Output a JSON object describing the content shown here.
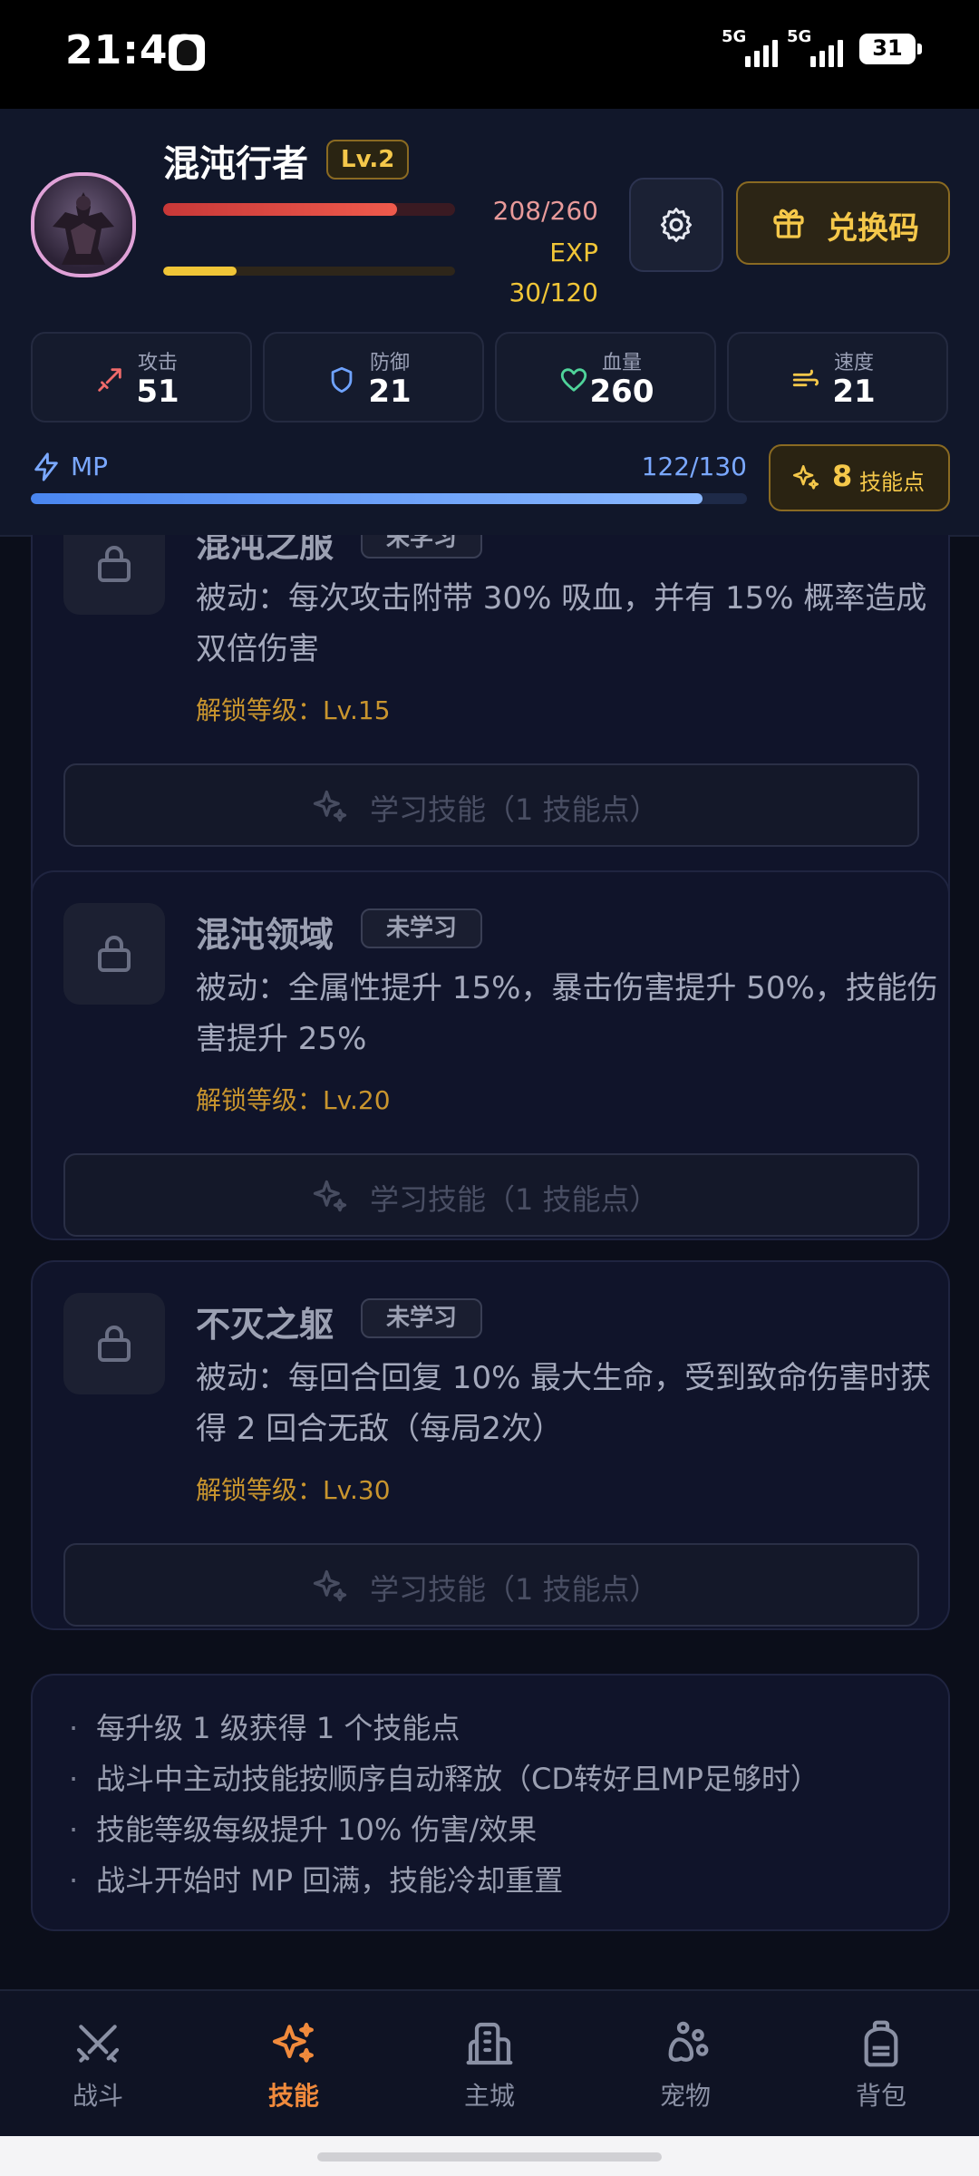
{
  "status_bar": {
    "time": "21:46",
    "net1": "5G",
    "net2": "5G",
    "battery": "31"
  },
  "player": {
    "name": "混沌行者",
    "level": "Lv.2",
    "hp_text": "208/260",
    "hp_fraction": 0.8,
    "exp_label": "EXP",
    "exp_text": "30/120",
    "exp_fraction": 0.25
  },
  "header": {
    "redeem_label": "兑换码"
  },
  "stats": [
    {
      "label": "攻击",
      "value": "51",
      "icon": "sword-icon"
    },
    {
      "label": "防御",
      "value": "21",
      "icon": "shield-icon"
    },
    {
      "label": "血量",
      "value": "260",
      "icon": "heart-icon"
    },
    {
      "label": "速度",
      "value": "21",
      "icon": "wind-icon"
    }
  ],
  "mp": {
    "label": "MP",
    "text": "122/130",
    "fraction": 0.938
  },
  "skill_points": {
    "count": "8",
    "label": "技能点"
  },
  "skills": [
    {
      "name": "混沌之服",
      "status": "未学习",
      "desc": "被动：每次攻击附带 30% 吸血，并有 15% 概率造成双倍伤害",
      "unlock": "解锁等级：Lv.15",
      "button": "学习技能（1 技能点）"
    },
    {
      "name": "混沌领域",
      "status": "未学习",
      "desc": "被动：全属性提升 15%，暴击伤害提升 50%，技能伤害提升 25%",
      "unlock": "解锁等级：Lv.20",
      "button": "学习技能（1 技能点）"
    },
    {
      "name": "不灭之躯",
      "status": "未学习",
      "desc": "被动：每回合回复 10% 最大生命，受到致命伤害时获得 2 回合无敌（每局2次）",
      "unlock": "解锁等级：Lv.30",
      "button": "学习技能（1 技能点）"
    }
  ],
  "tips": [
    "每升级 1 级获得 1 个技能点",
    "战斗中主动技能按顺序自动释放（CD转好且MP足够时）",
    "技能等级每级提升 10% 伤害/效果",
    "战斗开始时 MP 回满，技能冷却重置"
  ],
  "nav": [
    {
      "label": "战斗",
      "icon": "crossed-swords-icon",
      "active": false
    },
    {
      "label": "技能",
      "icon": "sparkles-icon",
      "active": true
    },
    {
      "label": "主城",
      "icon": "city-icon",
      "active": false
    },
    {
      "label": "宠物",
      "icon": "paw-icon",
      "active": false
    },
    {
      "label": "背包",
      "icon": "backpack-icon",
      "active": false
    }
  ],
  "colors": {
    "accent": "#f08a3c",
    "gold": "#f5c84a",
    "hp": "#ef5a4c",
    "mp": "#7aa8ff",
    "background": "#0b0e1a"
  }
}
